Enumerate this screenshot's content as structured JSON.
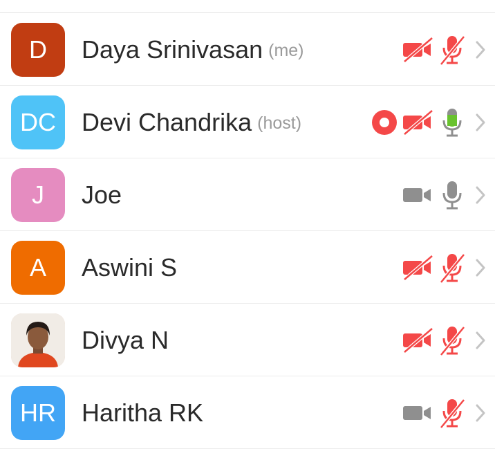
{
  "participants": [
    {
      "name": "Daya Srinivasan",
      "tag": "(me)",
      "initials": "D",
      "avatar_color": "#c13d12",
      "avatar_type": "initials",
      "recording": false,
      "camera": "off",
      "mic": "muted"
    },
    {
      "name": "Devi Chandrika",
      "tag": "(host)",
      "initials": "DC",
      "avatar_color": "#4fc3f7",
      "avatar_type": "initials",
      "recording": true,
      "camera": "off",
      "mic": "active"
    },
    {
      "name": "Joe",
      "tag": "",
      "initials": "J",
      "avatar_color": "#e58cc0",
      "avatar_type": "initials",
      "recording": false,
      "camera": "on",
      "mic": "on"
    },
    {
      "name": "Aswini S",
      "tag": "",
      "initials": "A",
      "avatar_color": "#ef6c00",
      "avatar_type": "initials",
      "recording": false,
      "camera": "off",
      "mic": "muted"
    },
    {
      "name": "Divya N",
      "tag": "",
      "initials": "",
      "avatar_color": "#e8c8b8",
      "avatar_type": "photo",
      "recording": false,
      "camera": "off",
      "mic": "muted"
    },
    {
      "name": "Haritha RK",
      "tag": "",
      "initials": "HR",
      "avatar_color": "#42a5f5",
      "avatar_type": "initials",
      "recording": false,
      "camera": "on",
      "mic": "muted"
    }
  ],
  "colors": {
    "red": "#f44848",
    "gray": "#8f8f8f",
    "green": "#69c22f",
    "chevron": "#c4c4c4"
  },
  "icons": {
    "record": "record-icon",
    "camera": "video-camera-icon",
    "mic": "microphone-icon",
    "chevron": "chevron-right-icon"
  }
}
